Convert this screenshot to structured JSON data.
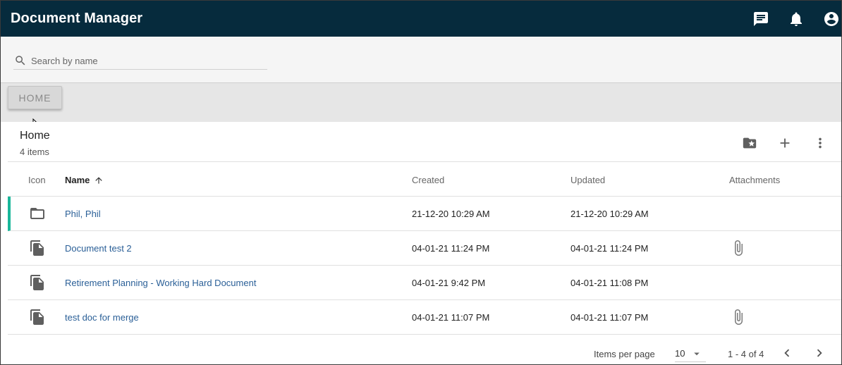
{
  "app": {
    "title": "Document Manager"
  },
  "topbar_icons": [
    "chat-icon",
    "bell-icon",
    "account-circle-icon"
  ],
  "search": {
    "placeholder": "Search by name",
    "value": ""
  },
  "breadcrumb": {
    "home_label": "HOME"
  },
  "panel": {
    "title": "Home",
    "subtitle": "4 items"
  },
  "panel_actions": [
    "folder-star-icon",
    "add-icon",
    "more-vert-icon"
  ],
  "table": {
    "columns": {
      "icon": "Icon",
      "name": "Name",
      "created": "Created",
      "updated": "Updated",
      "attachments": "Attachments"
    },
    "sort": {
      "column": "name",
      "direction": "ascending"
    },
    "rows": [
      {
        "icon": "folder-icon",
        "name": "Phil, Phil",
        "created": "21-12-20 10:29 AM",
        "updated": "21-12-20 10:29 AM",
        "has_attachment": false,
        "selected": true
      },
      {
        "icon": "document-icon",
        "name": "Document test 2",
        "created": "04-01-21 11:24 PM",
        "updated": "04-01-21 11:24 PM",
        "has_attachment": true,
        "selected": false
      },
      {
        "icon": "document-icon",
        "name": "Retirement Planning - Working Hard Document",
        "created": "04-01-21 9:42 PM",
        "updated": "04-01-21 11:08 PM",
        "has_attachment": false,
        "selected": false
      },
      {
        "icon": "document-icon",
        "name": "test doc for merge",
        "created": "04-01-21 11:07 PM",
        "updated": "04-01-21 11:07 PM",
        "has_attachment": true,
        "selected": false
      }
    ]
  },
  "paginator": {
    "items_per_page_label": "Items per page",
    "items_per_page": "10",
    "range_label": "1 - 4 of 4"
  },
  "colors": {
    "topbar": "#062b3d",
    "selected_accent": "#19b79a",
    "link": "#2a5f97"
  }
}
